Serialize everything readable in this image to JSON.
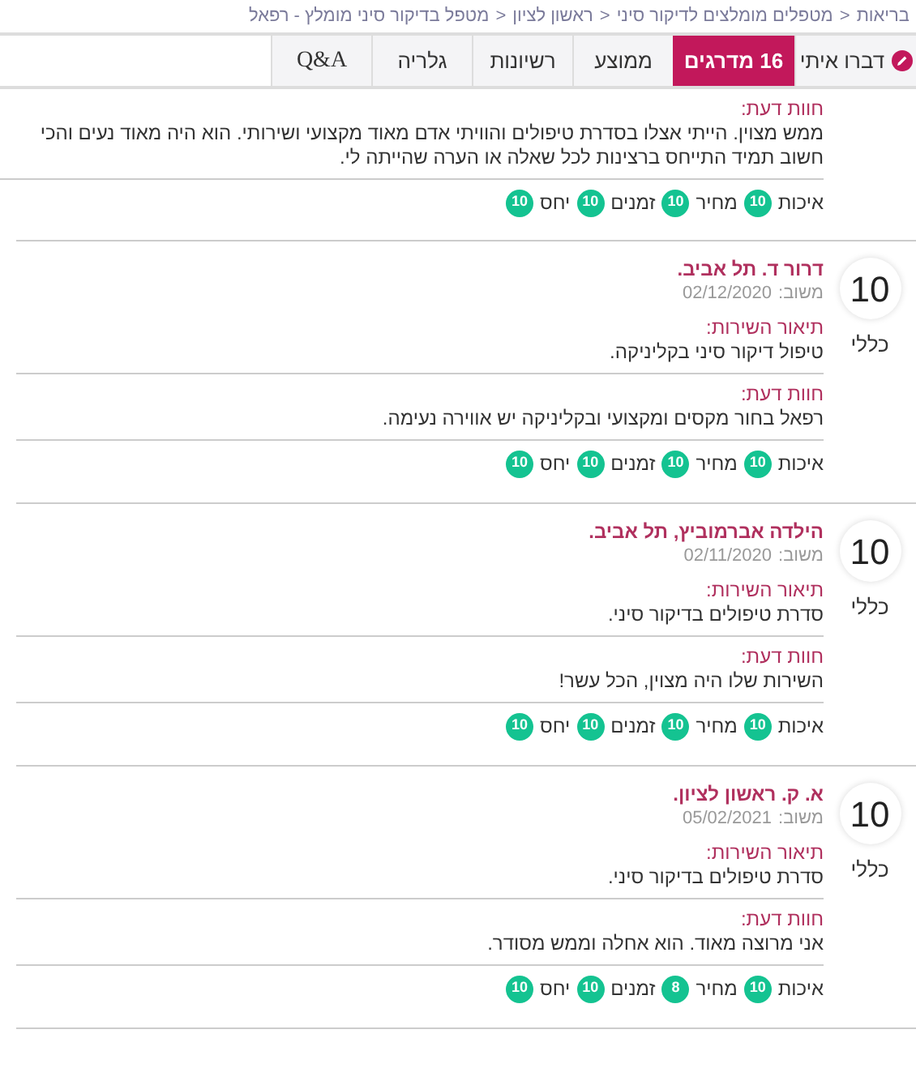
{
  "breadcrumb": {
    "separator": ">",
    "items": [
      "בריאות",
      "מטפלים מומלצים לדיקור סיני",
      "ראשון לציון",
      "מטפל בדיקור סיני מומלץ - רפאל"
    ]
  },
  "tabs": [
    {
      "label": "דברו איתי",
      "kind": "contact",
      "selected": false
    },
    {
      "label": "16 מדרגים",
      "kind": "plain",
      "selected": true
    },
    {
      "label": "ממוצע",
      "kind": "plain",
      "selected": false
    },
    {
      "label": "רשיונות",
      "kind": "plain",
      "selected": false
    },
    {
      "label": "גלריה",
      "kind": "plain",
      "selected": false
    },
    {
      "label": "Q&A",
      "kind": "serif",
      "selected": false
    }
  ],
  "partial_review": {
    "opinion_label": "חוות דעת:",
    "opinion": "ממש מצוין. הייתי אצלו בסדרת טיפולים והוויתי אדם מאוד מקצועי ושירותי. הוא היה מאוד נעים והכי חשוב תמיד התייחס ברצינות לכל שאלה או הערה שהייתה לי.",
    "ratings": [
      {
        "label": "איכות",
        "value": "10"
      },
      {
        "label": "מחיר",
        "value": "10"
      },
      {
        "label": "זמנים",
        "value": "10"
      },
      {
        "label": "יחס",
        "value": "10"
      }
    ]
  },
  "reviews": [
    {
      "score": "10",
      "score_label": "כללי",
      "name": "דרור ד. תל אביב.",
      "date_label": "משוב:",
      "date": "02/12/2020",
      "service_label": "תיאור השירות:",
      "service": "טיפול דיקור סיני בקליניקה.",
      "opinion_label": "חוות דעת:",
      "opinion": "רפאל בחור מקסים ומקצועי ובקליניקה יש אווירה נעימה.",
      "ratings": [
        {
          "label": "איכות",
          "value": "10"
        },
        {
          "label": "מחיר",
          "value": "10"
        },
        {
          "label": "זמנים",
          "value": "10"
        },
        {
          "label": "יחס",
          "value": "10"
        }
      ]
    },
    {
      "score": "10",
      "score_label": "כללי",
      "name": "הילדה אברמוביץ, תל אביב.",
      "date_label": "משוב:",
      "date": "02/11/2020",
      "service_label": "תיאור השירות:",
      "service": "סדרת טיפולים בדיקור סיני.",
      "opinion_label": "חוות דעת:",
      "opinion": "השירות שלו היה מצוין, הכל עשר!",
      "ratings": [
        {
          "label": "איכות",
          "value": "10"
        },
        {
          "label": "מחיר",
          "value": "10"
        },
        {
          "label": "זמנים",
          "value": "10"
        },
        {
          "label": "יחס",
          "value": "10"
        }
      ]
    },
    {
      "score": "10",
      "score_label": "כללי",
      "name": "א. ק. ראשון לציון.",
      "date_label": "משוב:",
      "date": "05/02/2021",
      "service_label": "תיאור השירות:",
      "service": "סדרת טיפולים בדיקור סיני.",
      "opinion_label": "חוות דעת:",
      "opinion": "אני מרוצה מאוד. הוא אחלה וממש מסודר.",
      "ratings": [
        {
          "label": "איכות",
          "value": "10"
        },
        {
          "label": "מחיר",
          "value": "8"
        },
        {
          "label": "זמנים",
          "value": "10"
        },
        {
          "label": "יחס",
          "value": "10"
        }
      ]
    }
  ]
}
